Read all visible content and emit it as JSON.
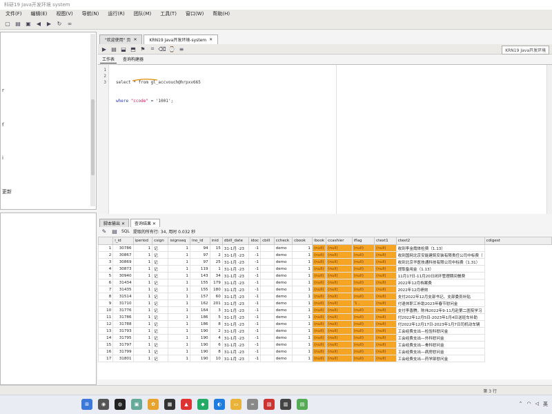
{
  "window": {
    "title": "科研19 Java开发环境 system"
  },
  "menu": [
    "文件(F)",
    "编辑(E)",
    "视图(V)",
    "导航(N)",
    "运行(R)",
    "团队(M)",
    "工具(T)",
    "窗口(W)",
    "帮助(H)"
  ],
  "editor_tabs": [
    {
      "label": "\"欢迎使用\" 页",
      "active": false
    },
    {
      "label": "KRN19 Java开发环境-system",
      "active": true
    }
  ],
  "connection_label": "KRN19 Java开发环境",
  "sub_tabs": [
    "工作表",
    "查询构建器"
  ],
  "editor": {
    "line_numbers": [
      "1",
      "2",
      "3"
    ],
    "line1": "select * from gl_accvouch@hrpxv665",
    "line2_where": "where",
    "line2_field": "\"ccode\"",
    "line2_rest": " = '1001';"
  },
  "left_labels": [
    "r",
    "f",
    "i",
    "更新",
    "f"
  ],
  "result_tabs": [
    "脚本输出",
    "查询结果"
  ],
  "result_status": {
    "prefix": "SQL",
    "fetched": "提取的所有行: 34, 用时 0.032 秒"
  },
  "columns": [
    "i_id",
    "iperiod",
    "csign",
    "isignseq",
    "ino_id",
    "inid",
    "dbill_date",
    "idoc",
    "cbill",
    "ccheck",
    "cbook",
    "ibook",
    "ccashier",
    "iflag",
    "ctext1",
    "ctext2",
    "cdigest"
  ],
  "rows": [
    [
      "1",
      "30786",
      "1",
      "记",
      "1",
      "94",
      "15",
      "31-1月 -23",
      "-1",
      "",
      "demo",
      "1",
      "(null)",
      "(null)",
      "(null)",
      "(null)",
      "收到李金霞体检费（1.13）"
    ],
    [
      "2",
      "30867",
      "1",
      "记",
      "1",
      "97",
      "2",
      "31-1月 -23",
      "-1",
      "",
      "demo",
      "1",
      "(null)",
      "(null)",
      "(null)",
      "(null)",
      "收到国网北京安能建筑安装有限责任公司中标费（"
    ],
    [
      "3",
      "30869",
      "1",
      "记",
      "1",
      "97",
      "25",
      "31-1月 -23",
      "-1",
      "",
      "demo",
      "1",
      "(null)",
      "(null)",
      "(null)",
      "(null)",
      "收到北京华医技通科技有限公司中标费（1.31）"
    ],
    [
      "4",
      "30873",
      "1",
      "记",
      "1",
      "119",
      "1",
      "31-1月 -23",
      "-1",
      "",
      "demo",
      "1",
      "(null)",
      "(null)",
      "(null)",
      "(null)",
      "提取备用金（1.13）"
    ],
    [
      "5",
      "30940",
      "1",
      "记",
      "1",
      "143",
      "34",
      "31-1月 -23",
      "-1",
      "",
      "demo",
      "1",
      "(null)",
      "(null)",
      "(null)",
      "(null)",
      "11月17日-11月20日闭环管理期间餐费"
    ],
    [
      "6",
      "31434",
      "1",
      "记",
      "1",
      "155",
      "179",
      "31-1月 -23",
      "-1",
      "",
      "demo",
      "1",
      "(null)",
      "(null)",
      "(null)",
      "(null)",
      "2022年12月档案费"
    ],
    [
      "7",
      "31435",
      "1",
      "记",
      "1",
      "155",
      "180",
      "31-1月 -23",
      "-1",
      "",
      "demo",
      "1",
      "(null)",
      "(null)",
      "(null)",
      "(null)",
      "2022年12月绩效"
    ],
    [
      "8",
      "31514",
      "1",
      "记",
      "1",
      "157",
      "60",
      "31-1月 -23",
      "-1",
      "",
      "demo",
      "1",
      "(null)",
      "(null)",
      "(null)",
      "(null)",
      "支付2022年12月支部书记、支部委员补贴"
    ],
    [
      "9",
      "31710",
      "1",
      "记",
      "1",
      "162",
      "201",
      "31-1月 -23",
      "-1",
      "",
      "demo",
      "1",
      "(null)",
      "(null)",
      "'1 ,",
      "(null)",
      "付退休职工补助2023年春节慰问金"
    ],
    [
      "10",
      "31776",
      "1",
      "记",
      "1",
      "164",
      "3",
      "31-1月 -23",
      "-1",
      "",
      "demo",
      "1",
      "(null)",
      "(null)",
      "(null)",
      "(null)",
      "支付李香腾，陈伟2022年9-11月赴第二医院学习"
    ],
    [
      "11",
      "31786",
      "1",
      "记",
      "1",
      "186",
      "5",
      "31-1月 -23",
      "-1",
      "",
      "demo",
      "1",
      "(null)",
      "(null)",
      "(null)",
      "(null)",
      "付2022年12月5日-2023年1月4日送班车补助"
    ],
    [
      "12",
      "31788",
      "1",
      "记",
      "1",
      "186",
      "8",
      "31-1月 -23",
      "-1",
      "",
      "demo",
      "1",
      "(null)",
      "(null)",
      "(null)",
      "(null)",
      "付2022年12月17日-2023年1月7日司机动车辆"
    ],
    [
      "13",
      "31793",
      "1",
      "记",
      "1",
      "190",
      "2",
      "31-1月 -23",
      "-1",
      "",
      "demo",
      "1",
      "(null)",
      "(null)",
      "(null)",
      "(null)",
      "工会经费支出—检验科慰问金"
    ],
    [
      "14",
      "31795",
      "1",
      "记",
      "1",
      "190",
      "4",
      "31-1月 -23",
      "-1",
      "",
      "demo",
      "1",
      "(null)",
      "(null)",
      "(null)",
      "(null)",
      "工会经费支出—外科慰问金"
    ],
    [
      "15",
      "31797",
      "1",
      "记",
      "1",
      "190",
      "6",
      "31-1月 -23",
      "-1",
      "",
      "demo",
      "1",
      "(null)",
      "(null)",
      "(null)",
      "(null)",
      "工会经费支出—骨科慰问金"
    ],
    [
      "16",
      "31799",
      "1",
      "记",
      "1",
      "190",
      "8",
      "31-1月 -23",
      "-1",
      "",
      "demo",
      "1",
      "(null)",
      "(null)",
      "(null)",
      "(null)",
      "工会经费支出—病房慰问金"
    ],
    [
      "17",
      "31801",
      "1",
      "记",
      "1",
      "190",
      "10",
      "31-1月 -23",
      "-1",
      "",
      "demo",
      "1",
      "(null)",
      "(null)",
      "(null)",
      "(null)",
      "工会经费支出—药学部慰问金"
    ]
  ],
  "status_bar": {
    "position": "第 3 行"
  },
  "tray": {
    "ime": "英"
  },
  "colors": {
    "null_highlight": "#f5a523"
  }
}
